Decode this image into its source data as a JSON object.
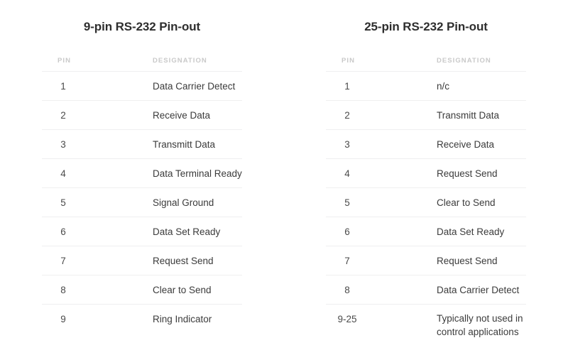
{
  "page": {
    "background_color": "#ffffff",
    "text_color": "#3b3b3b",
    "muted_color": "#c9c9c9",
    "divider_color": "#efeff0"
  },
  "tables": [
    {
      "id": "rs232-9pin",
      "title": "9-pin RS-232 Pin-out",
      "columns": {
        "pin": "PIN",
        "designation": "DESIGNATION"
      },
      "rows": [
        {
          "pin": "1",
          "designation": "Data Carrier Detect"
        },
        {
          "pin": "2",
          "designation": "Receive Data"
        },
        {
          "pin": "3",
          "designation": "Transmitt Data"
        },
        {
          "pin": "4",
          "designation": "Data Terminal Ready"
        },
        {
          "pin": "5",
          "designation": "Signal Ground"
        },
        {
          "pin": "6",
          "designation": "Data Set Ready"
        },
        {
          "pin": "7",
          "designation": "Request Send"
        },
        {
          "pin": "8",
          "designation": "Clear to Send"
        },
        {
          "pin": "9",
          "designation": "Ring Indicator"
        }
      ]
    },
    {
      "id": "rs232-25pin",
      "title": "25-pin RS-232 Pin-out",
      "columns": {
        "pin": "PIN",
        "designation": "DESIGNATION"
      },
      "rows": [
        {
          "pin": "1",
          "designation": "n/c"
        },
        {
          "pin": "2",
          "designation": "Transmitt Data"
        },
        {
          "pin": "3",
          "designation": "Receive Data"
        },
        {
          "pin": "4",
          "designation": "Request Send"
        },
        {
          "pin": "5",
          "designation": "Clear to Send"
        },
        {
          "pin": "6",
          "designation": "Data Set Ready"
        },
        {
          "pin": "7",
          "designation": "Request Send"
        },
        {
          "pin": "8",
          "designation": "Data Carrier Detect"
        },
        {
          "pin": "9-25",
          "designation_line1": "Typically not used in",
          "designation_line2": "control applications"
        }
      ]
    }
  ]
}
